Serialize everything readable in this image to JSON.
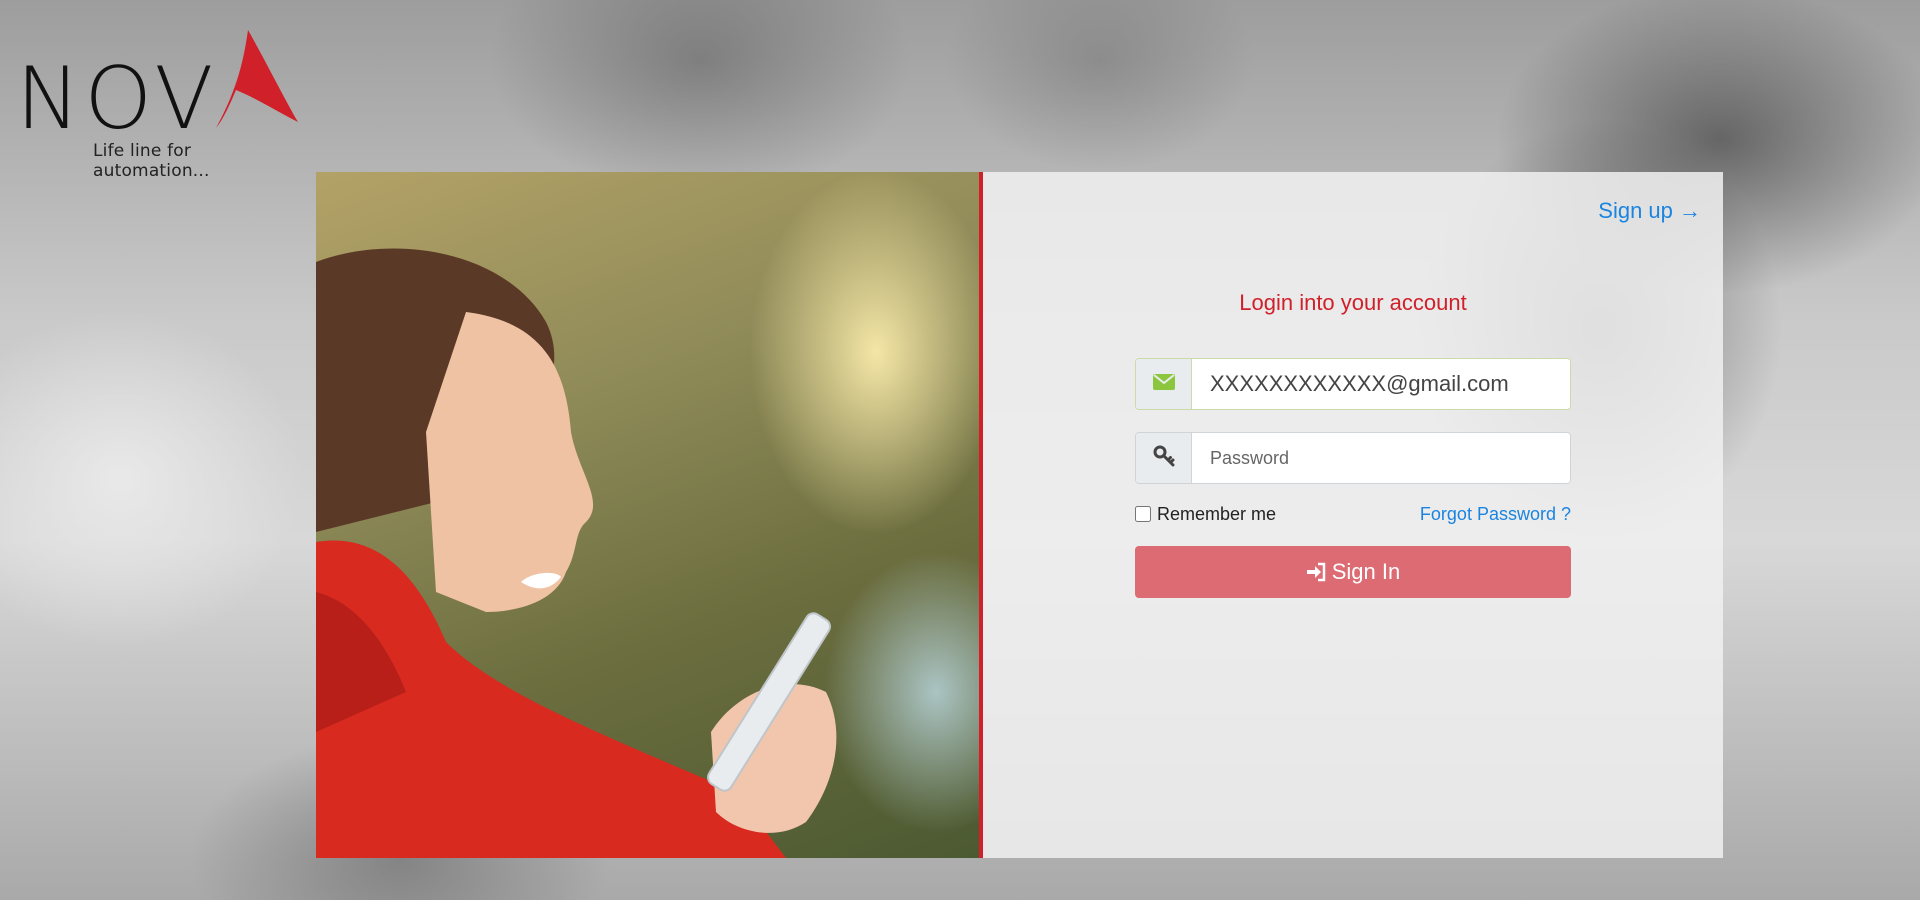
{
  "brand": {
    "logo_text": "NOVA",
    "tagline": "Life line for automation...",
    "accent_color": "#d0202a"
  },
  "auth": {
    "signup_label": "Sign up →",
    "title": "Login into your account",
    "email_value": "XXXXXXXXXXXX@gmail.com",
    "password_placeholder": "Password",
    "remember_label": "Remember me",
    "remember_checked": false,
    "forgot_label": "Forgot Password ?",
    "signin_label": "Sign In"
  },
  "icons": {
    "email": "envelope-icon",
    "password": "key-icon",
    "signin": "sign-in-icon"
  },
  "colors": {
    "link": "#1a84e0",
    "button": "#dd6b73",
    "email_icon": "#8cc63f"
  }
}
